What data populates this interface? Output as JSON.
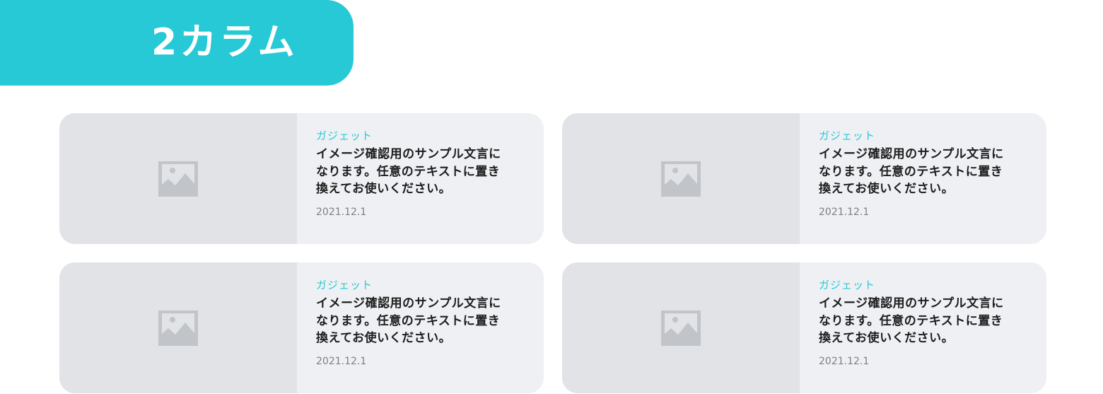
{
  "section": {
    "title": "2カラム"
  },
  "colors": {
    "accent": "#27c9d6",
    "card_background": "#eff0f4",
    "thumbnail_background": "#e1e3e6",
    "placeholder_icon": "#c1c4c8",
    "date_text": "#7b7f84"
  },
  "cards": [
    {
      "category": "ガジェット",
      "title_lines": [
        "イメージ確認用のサンプル文言に",
        "なります。任意のテキストに置き",
        "換えてお使いください。"
      ],
      "date": "2021.12.1",
      "thumbnail_icon": "image-placeholder-icon"
    },
    {
      "category": "ガジェット",
      "title_lines": [
        "イメージ確認用のサンプル文言に",
        "なります。任意のテキストに置き",
        "換えてお使いください。"
      ],
      "date": "2021.12.1",
      "thumbnail_icon": "image-placeholder-icon"
    },
    {
      "category": "ガジェット",
      "title_lines": [
        "イメージ確認用のサンプル文言に",
        "なります。任意のテキストに置き",
        "換えてお使いください。"
      ],
      "date": "2021.12.1",
      "thumbnail_icon": "image-placeholder-icon"
    },
    {
      "category": "ガジェット",
      "title_lines": [
        "イメージ確認用のサンプル文言に",
        "なります。任意のテキストに置き",
        "換えてお使いください。"
      ],
      "date": "2021.12.1",
      "thumbnail_icon": "image-placeholder-icon"
    }
  ]
}
